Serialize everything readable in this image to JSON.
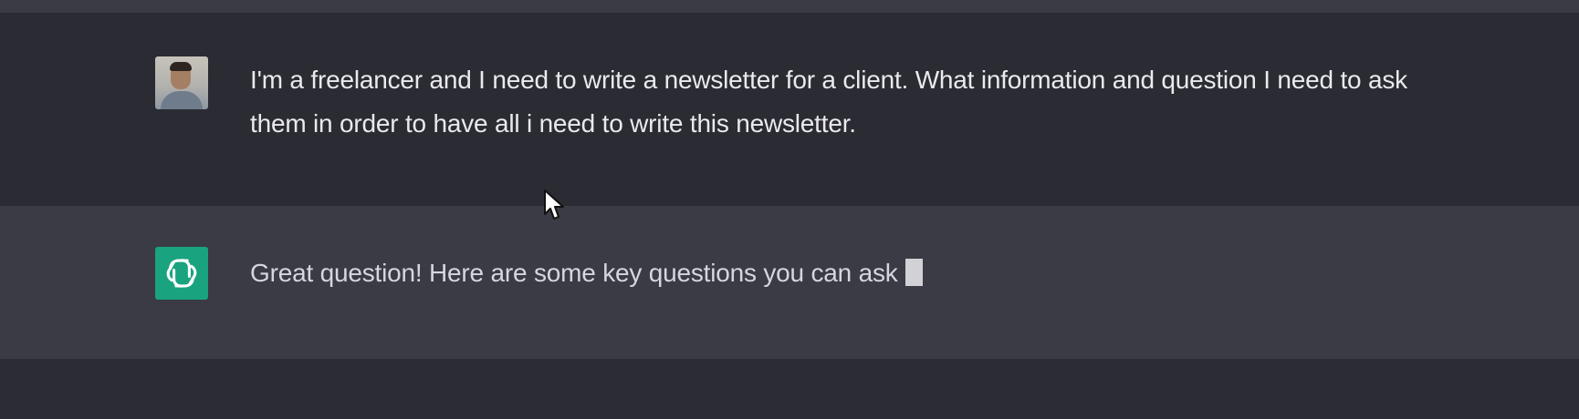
{
  "conversation": {
    "user_message": {
      "text": "I'm a freelancer and I need to write a newsletter for a client. What information and question I need to ask them in order to have all i need to write this newsletter.",
      "avatar_icon": "user-photo-avatar"
    },
    "assistant_message": {
      "text": "Great question! Here are some key questions you can ask",
      "avatar_icon": "openai-logo-icon",
      "avatar_color": "#19a37f"
    }
  },
  "pointer": {
    "icon": "mouse-pointer-icon"
  },
  "colors": {
    "background": "#343541",
    "user_row": "#2a2b33",
    "assistant_row": "#3a3b45",
    "text": "#e9e9ee",
    "brand": "#19a37f"
  }
}
